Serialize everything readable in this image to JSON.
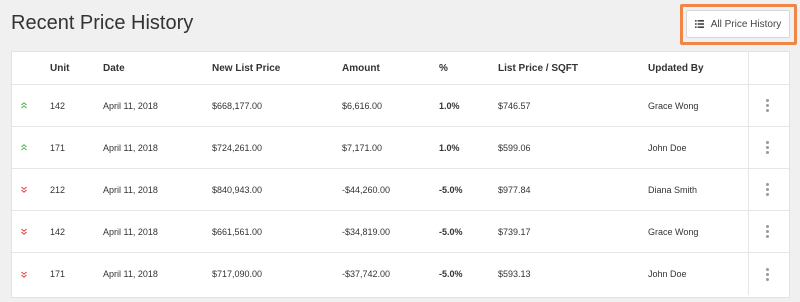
{
  "page": {
    "title": "Recent Price History"
  },
  "toolbar": {
    "all_history_label": "All Price History",
    "all_history_icon": "list-icon"
  },
  "colors": {
    "up": "#4caf50",
    "down": "#e53935",
    "highlight": "#f08548"
  },
  "table": {
    "headers": [
      "Unit",
      "Date",
      "New List Price",
      "Amount",
      "%",
      "List Price / SQFT",
      "Updated By"
    ],
    "rows": [
      {
        "direction": "up",
        "unit": "142",
        "date": "April 11, 2018",
        "new_list_price": "$668,177.00",
        "amount": "$6,616.00",
        "pct": "1.0%",
        "price_sqft": "$746.57",
        "updated_by": "Grace Wong"
      },
      {
        "direction": "up",
        "unit": "171",
        "date": "April 11, 2018",
        "new_list_price": "$724,261.00",
        "amount": "$7,171.00",
        "pct": "1.0%",
        "price_sqft": "$599.06",
        "updated_by": "John Doe"
      },
      {
        "direction": "down",
        "unit": "212",
        "date": "April 11, 2018",
        "new_list_price": "$840,943.00",
        "amount": "-$44,260.00",
        "pct": "-5.0%",
        "price_sqft": "$977.84",
        "updated_by": "Diana Smith"
      },
      {
        "direction": "down",
        "unit": "142",
        "date": "April 11, 2018",
        "new_list_price": "$661,561.00",
        "amount": "-$34,819.00",
        "pct": "-5.0%",
        "price_sqft": "$739.17",
        "updated_by": "Grace Wong"
      },
      {
        "direction": "down",
        "unit": "171",
        "date": "April 11, 2018",
        "new_list_price": "$717,090.00",
        "amount": "-$37,742.00",
        "pct": "-5.0%",
        "price_sqft": "$593.13",
        "updated_by": "John Doe"
      }
    ]
  }
}
